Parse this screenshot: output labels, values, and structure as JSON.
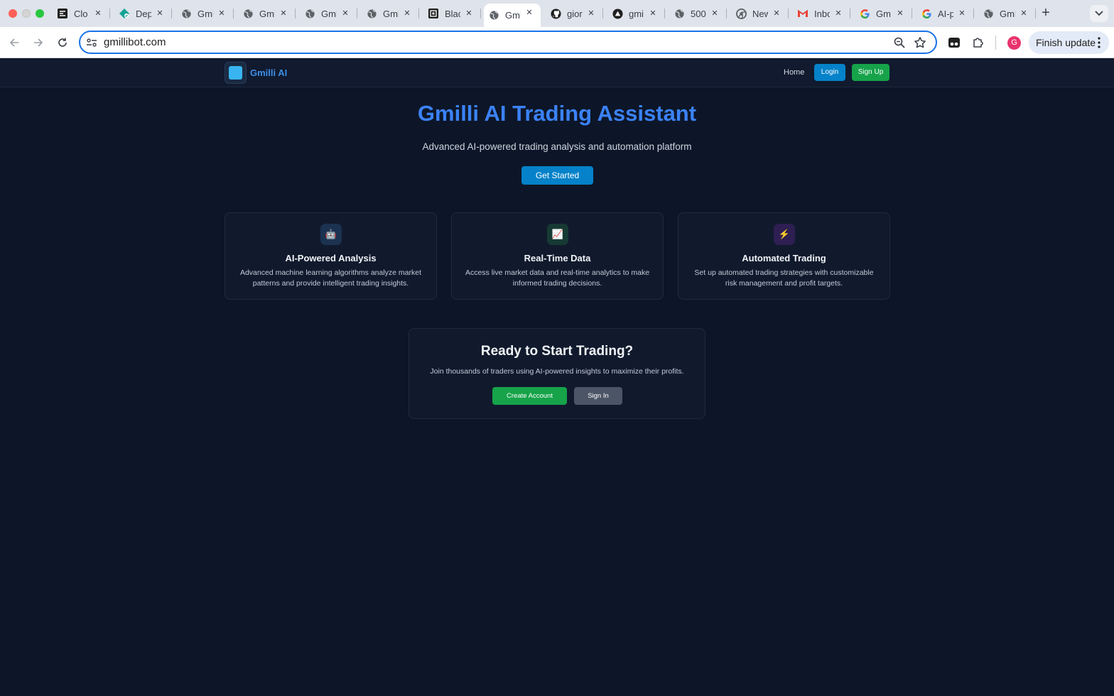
{
  "browser": {
    "tabs": [
      {
        "title": "Clo",
        "favicon": "clone-icon",
        "active": false
      },
      {
        "title": "Dep",
        "favicon": "deploy-icon",
        "active": false
      },
      {
        "title": "Gmi",
        "favicon": "globe-icon",
        "active": false
      },
      {
        "title": "Gmi",
        "favicon": "globe-icon",
        "active": false
      },
      {
        "title": "Gmi",
        "favicon": "globe-icon",
        "active": false
      },
      {
        "title": "Gmi",
        "favicon": "globe-icon",
        "active": false
      },
      {
        "title": "Blac",
        "favicon": "blackbox-icon",
        "active": false
      },
      {
        "title": "Gmi",
        "favicon": "globe-icon",
        "active": true
      },
      {
        "title": "gior",
        "favicon": "github-icon",
        "active": false
      },
      {
        "title": "gmi",
        "favicon": "vercel-icon",
        "active": false
      },
      {
        "title": "500",
        "favicon": "globe-icon",
        "active": false
      },
      {
        "title": "New",
        "favicon": "chrome-icon",
        "active": false
      },
      {
        "title": "Inbo",
        "favicon": "gmail-icon",
        "active": false
      },
      {
        "title": "Gm",
        "favicon": "google-icon",
        "active": false
      },
      {
        "title": "AI-p",
        "favicon": "google-icon",
        "active": false
      },
      {
        "title": "Gmi",
        "favicon": "globe-icon",
        "active": false
      }
    ],
    "url": "gmillibot.com",
    "avatar_letter": "G",
    "finish_update_label": "Finish update"
  },
  "site": {
    "brand": "Gmilli AI",
    "nav": {
      "home": "Home",
      "login": "Login",
      "signup": "Sign Up"
    },
    "hero": {
      "title": "Gmilli AI Trading Assistant",
      "subtitle": "Advanced AI-powered trading analysis and automation platform",
      "cta": "Get Started"
    },
    "features": [
      {
        "icon": "🤖",
        "icon_name": "robot-icon",
        "icon_bg": "#1b3250",
        "title": "AI-Powered Analysis",
        "desc": "Advanced machine learning algorithms analyze market patterns and provide intelligent trading insights."
      },
      {
        "icon": "📈",
        "icon_name": "chart-increasing-icon",
        "icon_bg": "#163a33",
        "title": "Real-Time Data",
        "desc": "Access live market data and real-time analytics to make informed trading decisions."
      },
      {
        "icon": "⚡",
        "icon_name": "lightning-icon",
        "icon_bg": "#2e1f52",
        "title": "Automated Trading",
        "desc": "Set up automated trading strategies with customizable risk management and profit targets."
      }
    ],
    "cta_section": {
      "title": "Ready to Start Trading?",
      "subtitle": "Join thousands of traders using AI-powered insights to maximize their profits.",
      "create_account": "Create Account",
      "sign_in": "Sign In"
    }
  },
  "colors": {
    "page_bg": "#0d1628",
    "accent_blue": "#3b82f6",
    "button_blue": "#0582c9",
    "button_green": "#16a34a",
    "button_gray": "#4b5565"
  }
}
